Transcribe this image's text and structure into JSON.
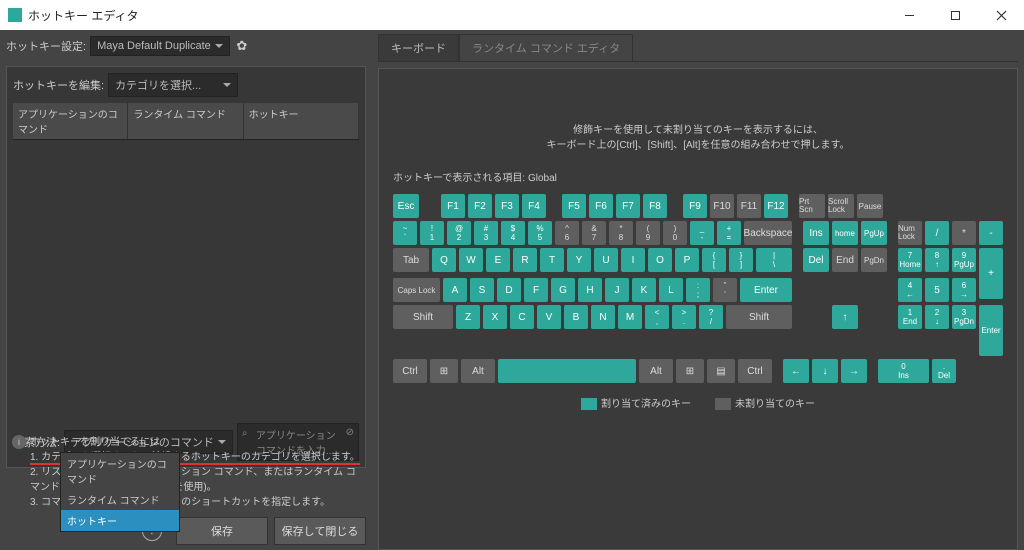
{
  "window": {
    "title": "ホットキー エディタ"
  },
  "left": {
    "settings_label": "ホットキー設定:",
    "settings_value": "Maya Default Duplicate",
    "edit_label": "ホットキーを編集:",
    "edit_value": "カテゴリを選択...",
    "cols": {
      "app": "アプリケーションのコマンド",
      "runtime": "ランタイム コマンド",
      "hotkey": "ホットキー"
    },
    "search_label": "検索方法:",
    "search_value": "アプリケーションのコマンド",
    "search_placeholder": "アプリケーション コマンドを入力...",
    "dropdown": {
      "opt0": "アプリケーションのコマンド",
      "opt1": "ランタイム コマンド",
      "opt2": "ホットキー"
    },
    "info_title": "ホットキーを割り当てるには",
    "step1": "1. カテゴリを選択するか、希望するホットキーのカテゴリを選択します。",
    "step2": "2. リストから編集するアプリケーション コマンド、またはランタイム コマンドを見つけます(または検索を使用)。",
    "step3": "3. コマンドを選択し、ホットキーのショートカットを指定します。",
    "save": "保存",
    "save_close": "保存して閉じる"
  },
  "right": {
    "tab_kb": "キーボード",
    "tab_rt": "ランタイム コマンド エディタ",
    "hint1": "修飾キーを使用して未割り当てのキーを表示するには、",
    "hint2": "キーボード上の[Ctrl]、[Shift]、[Alt]を任意の組み合わせで押します。",
    "scope": "ホットキーで表示される項目: Global",
    "legend_assigned": "割り当て済みのキー",
    "legend_un": "未割り当てのキー"
  },
  "keys": {
    "esc": "Esc",
    "f1": "F1",
    "f2": "F2",
    "f3": "F3",
    "f4": "F4",
    "f5": "F5",
    "f6": "F6",
    "f7": "F7",
    "f8": "F8",
    "f9": "F9",
    "f10": "F10",
    "f11": "F11",
    "f12": "F12",
    "prtscn": "Prt Scn",
    "scroll": "Scroll Lock",
    "pause": "Pause",
    "tilde": "~",
    "n1": "1",
    "n2": "2",
    "n3": "3",
    "n4": "4",
    "n5": "5",
    "n6": "6",
    "n7": "7",
    "n8": "8",
    "n9": "9",
    "n0": "0",
    "minus": "-",
    "plus": "+",
    "back": "Backspace",
    "s1": "!",
    "s2": "@",
    "s3": "#",
    "s4": "$",
    "s5": "%",
    "s6": "^",
    "s7": "&",
    "s8": "*",
    "s9": "(",
    "s0": ")",
    "smin": "_",
    "seq": "=",
    "ins": "Ins",
    "home": "home",
    "pgup": "PgUp",
    "del": "Del",
    "end": "End",
    "pgdn": "PgDn",
    "numlock": "Num Lock",
    "div": "/",
    "mul": "*",
    "sub": "-",
    "add": "+",
    "tab": "Tab",
    "q": "Q",
    "w": "W",
    "e": "E",
    "r": "R",
    "t": "T",
    "y": "Y",
    "u": "U",
    "i": "I",
    "o": "O",
    "p": "P",
    "lbr": "{",
    "rbr": "}",
    "lbrs": "[",
    "rbrs": "]",
    "bslash": "|",
    "bslashs": "\\",
    "caps": "Caps Lock",
    "a": "A",
    "s": "S",
    "d": "D",
    "f": "F",
    "g": "G",
    "h": "H",
    "j": "J",
    "k": "K",
    "l": "L",
    "semi": ":",
    "semis": ";",
    "quote": "\"",
    "quotes": "'",
    "enter": "Enter",
    "shift": "Shift",
    "z": "Z",
    "x": "X",
    "c": "C",
    "v": "V",
    "b": "B",
    "n": "N",
    "m": "M",
    "comma": "<",
    "commas": ",",
    "dot": ">",
    "dots": ".",
    "slash": "?",
    "slashs": "/",
    "ctrl": "Ctrl",
    "alt": "Alt",
    "np7": "7",
    "np8": "8",
    "np9": "9",
    "np4": "4",
    "np5": "5",
    "np6": "6",
    "np1": "1",
    "np2": "2",
    "np3": "3",
    "np0": "0",
    "npd": ".",
    "nph": "Home",
    "npu": "↑",
    "nppu": "PgUp",
    "npl": "←",
    "npr": "→",
    "npe": "End",
    "npdn": "↓",
    "nppd": "PgDn",
    "npins": "Ins",
    "npdel": "Del",
    "up": "↑",
    "down": "↓",
    "left": "←",
    "right": "→",
    "npenter": "Enter"
  }
}
